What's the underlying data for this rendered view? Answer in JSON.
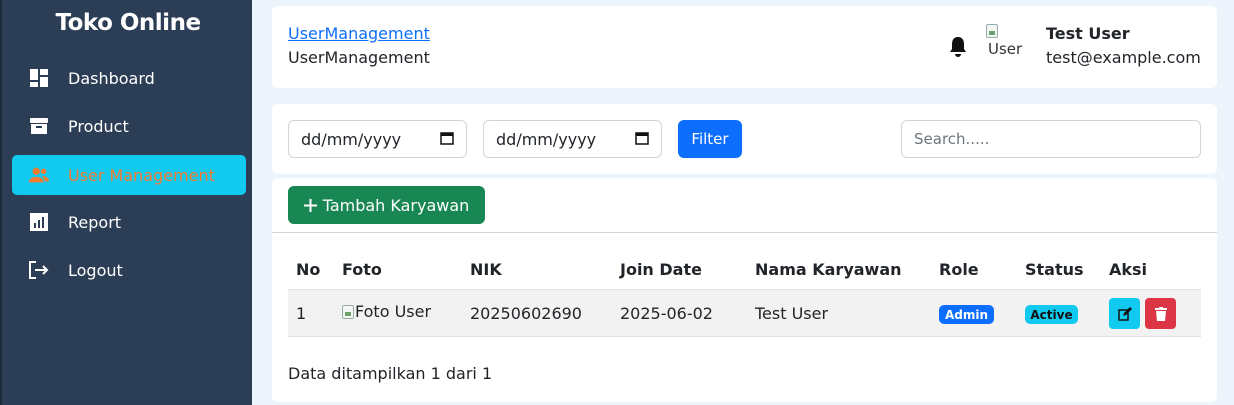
{
  "sidebar": {
    "brand": "Toko Online",
    "items": [
      {
        "label": "Dashboard",
        "icon": "dashboard-icon"
      },
      {
        "label": "Product",
        "icon": "archive-icon"
      },
      {
        "label": "User Management",
        "icon": "users-icon",
        "active": true
      },
      {
        "label": "Report",
        "icon": "chart-icon"
      },
      {
        "label": "Logout",
        "icon": "logout-icon"
      }
    ]
  },
  "header": {
    "breadcrumb_link": "UserManagement",
    "breadcrumb_text": "UserManagement",
    "avatar_alt": "User",
    "user_name": "Test User",
    "user_email": "test@example.com"
  },
  "filter": {
    "date_start": "dd/mm/yyyy",
    "date_end": "dd/mm/yyyy",
    "filter_label": "Filter",
    "search_placeholder": "Search....."
  },
  "main": {
    "add_label": "Tambah Karyawan",
    "columns": [
      "No",
      "Foto",
      "NIK",
      "Join Date",
      "Nama Karyawan",
      "Role",
      "Status",
      "Aksi"
    ],
    "rows": [
      {
        "no": "1",
        "foto": "Foto User",
        "nik": "20250602690",
        "join_date": "2025-06-02",
        "nama": "Test User",
        "role": "Admin",
        "status": "Active"
      }
    ],
    "footer": "Data ditampilkan 1 dari 1"
  },
  "colors": {
    "sidebar_bg": "#2b3e55",
    "active_bg": "#12c9ef",
    "active_text": "#f07a2e",
    "primary": "#0d6efd",
    "success": "#198754",
    "danger": "#dc3545"
  }
}
